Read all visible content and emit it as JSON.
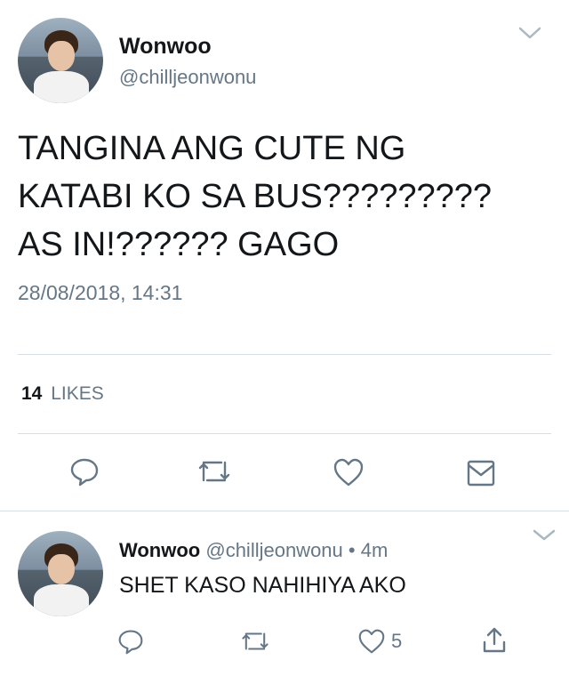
{
  "main_tweet": {
    "display_name": "Wonwoo",
    "handle": "@chilljeonwonu",
    "text_lines": [
      "TANGINA ANG CUTE NG",
      "KATABI KO SA BUS?????????",
      "AS IN!?????? GAGO"
    ],
    "timestamp": "28/08/2018, 14:31",
    "likes_count": "14",
    "likes_label": "LIKES"
  },
  "reply_tweet": {
    "display_name": "Wonwoo",
    "handle": "@chilljeonwonu",
    "separator": "•",
    "age": "4m",
    "text": "SHET KASO NAHIHIYA AKO",
    "like_count": "5"
  },
  "icons": {
    "menu": "chevron-down-icon",
    "reply": "reply-bubble-icon",
    "retweet": "retweet-icon",
    "like": "heart-icon",
    "message": "envelope-icon",
    "share": "share-icon"
  },
  "colors": {
    "text": "#14171a",
    "secondary": "#657786",
    "divider": "#d8dde1"
  }
}
